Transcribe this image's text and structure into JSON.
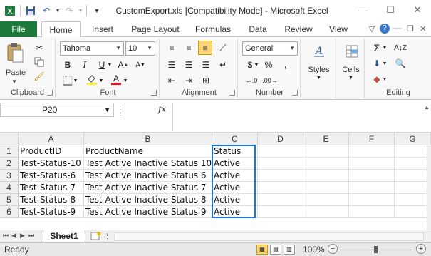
{
  "window": {
    "title": "CustomExport.xls  [Compatibility Mode]  -  Microsoft Excel",
    "min_label": "—",
    "max_label": "☐",
    "close_label": "✕"
  },
  "ribbon_tabs": [
    "File",
    "Home",
    "Insert",
    "Page Layout",
    "Formulas",
    "Data",
    "Review",
    "View"
  ],
  "ribbon": {
    "clipboard": {
      "label": "Clipboard",
      "paste_label": "Paste"
    },
    "font": {
      "label": "Font",
      "font_name": "Tahoma",
      "font_size": "10"
    },
    "alignment": {
      "label": "Alignment"
    },
    "number": {
      "label": "Number",
      "format": "General"
    },
    "styles": {
      "label": "Styles"
    },
    "cells": {
      "label": "Cells"
    },
    "editing": {
      "label": "Editing"
    }
  },
  "formula_bar": {
    "name_box": "P20",
    "fx_label": "fx",
    "formula": ""
  },
  "columns": [
    "A",
    "B",
    "C",
    "D",
    "E",
    "F",
    "G"
  ],
  "rows": [
    "1",
    "2",
    "3",
    "4",
    "5",
    "6"
  ],
  "cells": [
    [
      "ProductID",
      "ProductName",
      "Status"
    ],
    [
      "Test-Status-10",
      "Test Active Inactive Status 10",
      "Active"
    ],
    [
      "Test-Status-6",
      "Test Active Inactive Status 6",
      "Active"
    ],
    [
      "Test-Status-7",
      "Test Active Inactive Status 7",
      "Active"
    ],
    [
      "Test-Status-8",
      "Test Active Inactive Status 8",
      "Active"
    ],
    [
      "Test-Status-9",
      "Test Active Inactive Status 9",
      "Active"
    ]
  ],
  "sheets": [
    "Sheet1"
  ],
  "status": {
    "text": "Ready",
    "zoom": "100%",
    "zoom_minus": "−",
    "zoom_plus": "+"
  },
  "colors": {
    "file_tab": "#1e7a3c",
    "selection_border": "#1a73e8",
    "accent": "#2b579a"
  }
}
